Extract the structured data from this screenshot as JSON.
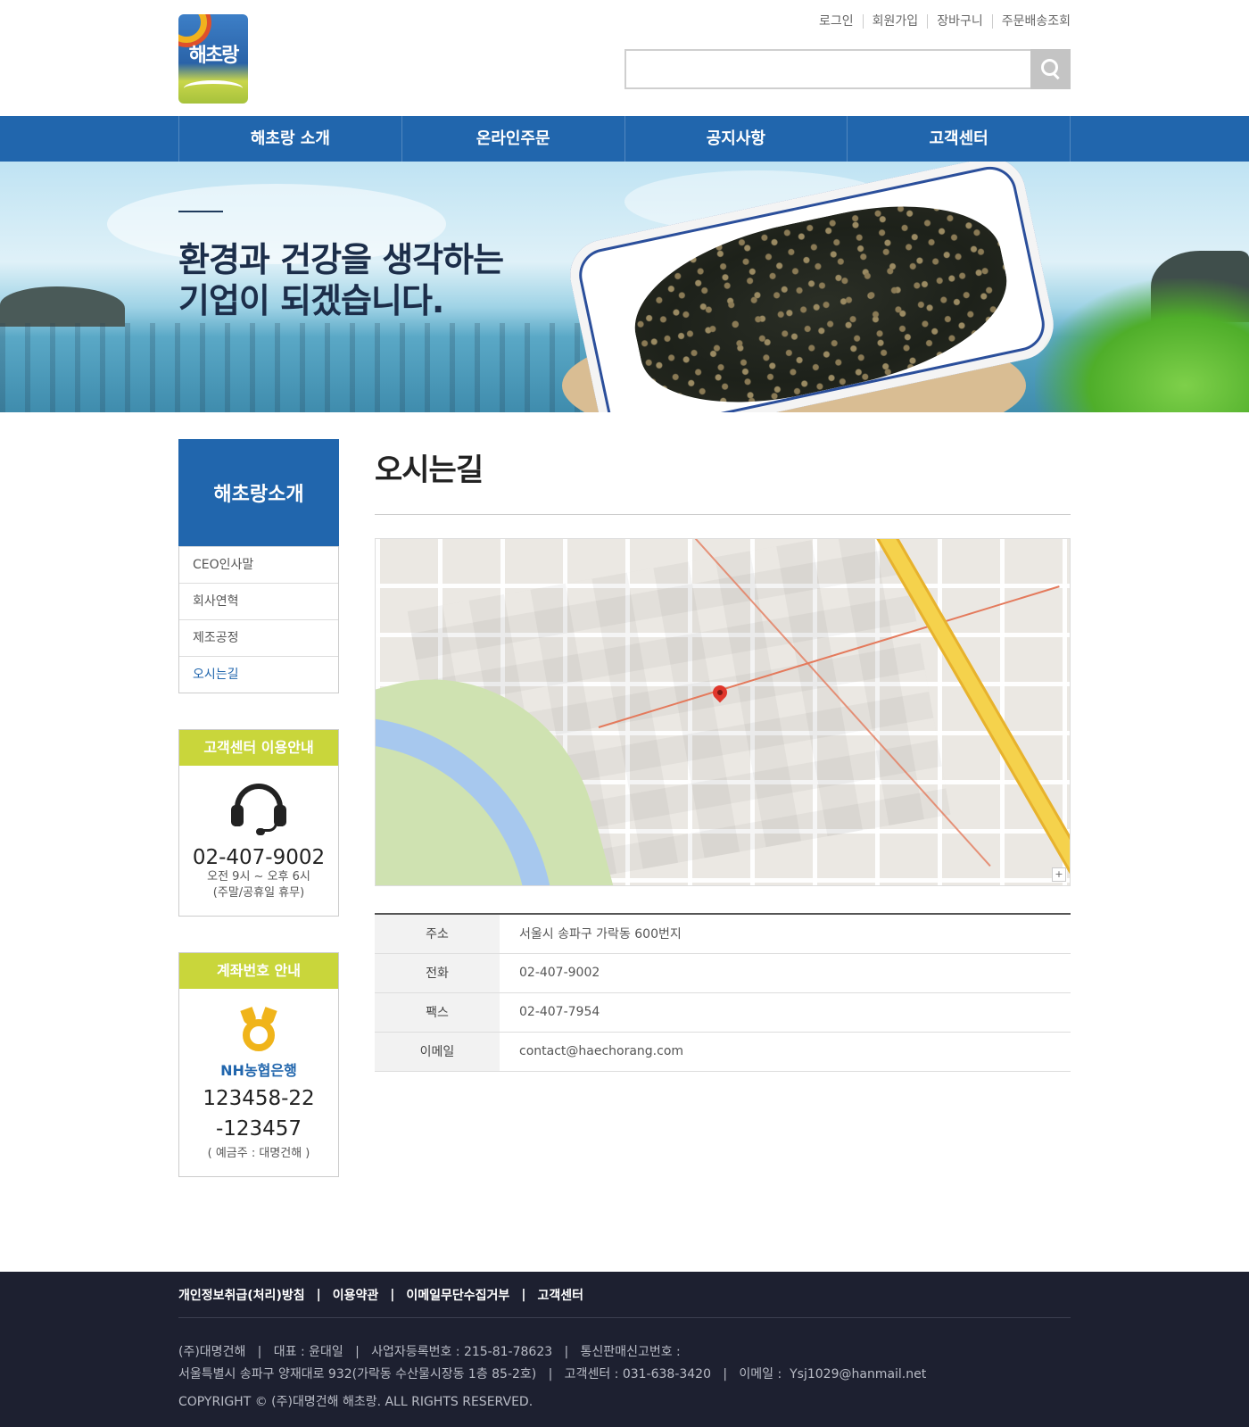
{
  "util_menu": [
    "로그인",
    "회원가입",
    "장바구니",
    "주문배송조회"
  ],
  "logo_text": "해초랑",
  "search": {
    "placeholder": ""
  },
  "nav": [
    "해초랑 소개",
    "온라인주문",
    "공지사항",
    "고객센터"
  ],
  "banner": {
    "line1": "환경과 건강을 생각하는",
    "line2": "기업이 되겠습니다."
  },
  "sidebar": {
    "title": "해초랑소개",
    "items": [
      {
        "label": "CEO인사말",
        "active": false
      },
      {
        "label": "회사연혁",
        "active": false
      },
      {
        "label": "제조공정",
        "active": false
      },
      {
        "label": "오시는길",
        "active": true
      }
    ]
  },
  "customer_center": {
    "title": "고객센터 이용안내",
    "icon": "headset-icon",
    "phone": "02-407-9002",
    "hours": "오전 9시 ~ 오후 6시",
    "holiday": "(주말/공휴일 휴무)"
  },
  "account": {
    "title": "계좌번호 안내",
    "icon": "nh-bank-logo-icon",
    "bank": "NH농협은행",
    "number_line1": "123458-22",
    "number_line2": "-123457",
    "holder": "( 예금주 : 대명건해 )"
  },
  "main": {
    "title": "오시는길",
    "info": [
      {
        "label": "주소",
        "value": "서울시 송파구 가락동 600번지"
      },
      {
        "label": "전화",
        "value": "02-407-9002"
      },
      {
        "label": "팩스",
        "value": "02-407-7954"
      },
      {
        "label": "이메일",
        "value": "contact@haechorang.com"
      }
    ]
  },
  "footer": {
    "links": [
      "개인정보취급(처리)방침",
      "이용약관",
      "이메일무단수집거부",
      "고객센터"
    ],
    "info_line1": "(주)대명건해   |   대표 : 윤대일   |   사업자등록번호 : 215-81-78623   |   통신판매신고번호 :",
    "info_line2": "서울특별시 송파구 양재대로 932(가락동 수산물시장동 1층 85-2호)   |   고객센터 : 031-638-3420   |   이메일 :  Ysj1029@hanmail.net",
    "copyright": "COPYRIGHT © (주)대명건해 해초랑. ALL RIGHTS RESERVED."
  },
  "colors": {
    "primary": "#2166ad",
    "accent": "#c9d63b",
    "footer_bg": "#1d2030"
  }
}
